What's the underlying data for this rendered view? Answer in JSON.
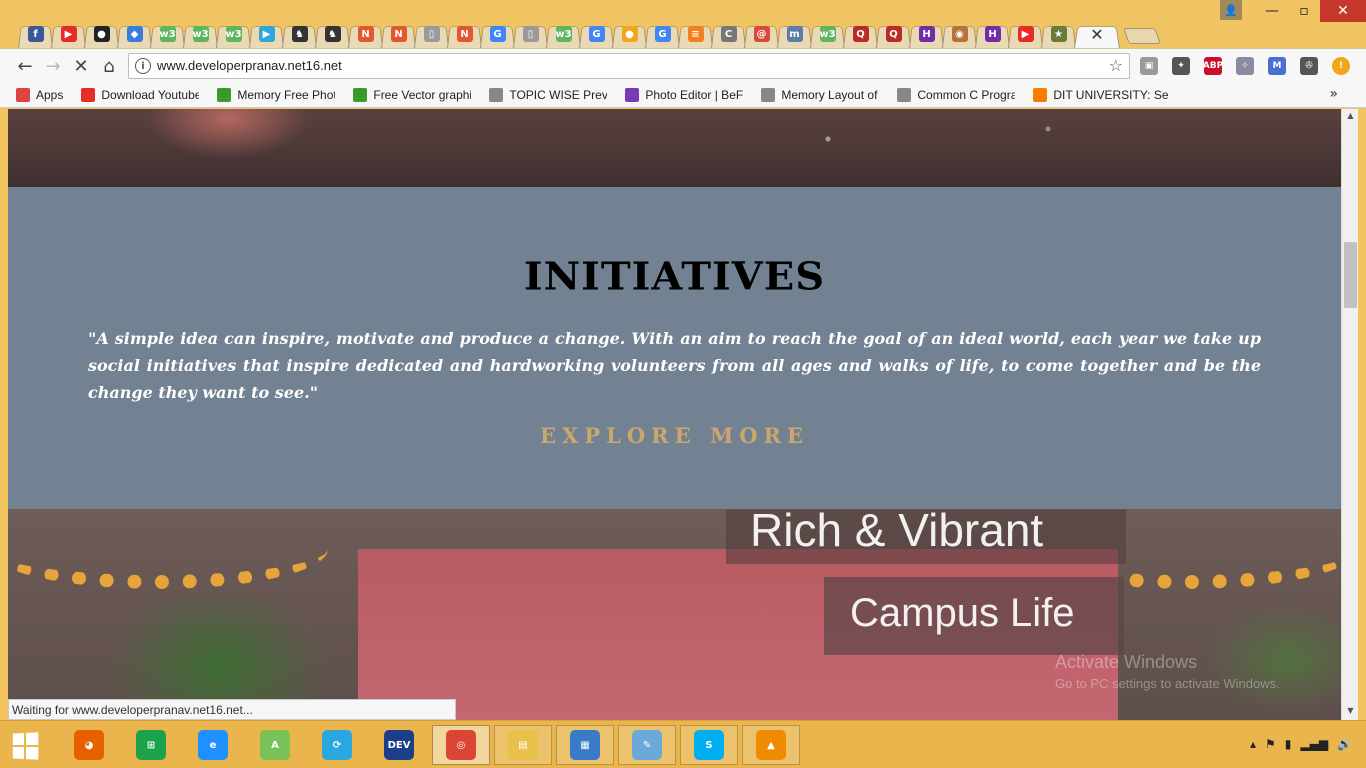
{
  "browser": {
    "url": "www.developerpranav.net16.net",
    "status_text": "Waiting for www.developerpranav.net16.net...",
    "tabs": [
      {
        "icon": "facebook-icon",
        "glyph": "f",
        "color": "#3b5998"
      },
      {
        "icon": "youtube-icon",
        "glyph": "▶",
        "color": "#e52d27"
      },
      {
        "icon": "github-icon",
        "glyph": "●",
        "color": "#222222"
      },
      {
        "icon": "google-ads-icon",
        "glyph": "◆",
        "color": "#3b7be0"
      },
      {
        "icon": "w3schools-icon",
        "glyph": "w3",
        "color": "#5fb55f"
      },
      {
        "icon": "w3schools-icon",
        "glyph": "w3",
        "color": "#5fb55f"
      },
      {
        "icon": "w3schools-icon",
        "glyph": "w3",
        "color": "#5fb55f"
      },
      {
        "icon": "play-icon",
        "glyph": "▶",
        "color": "#2fa7d8"
      },
      {
        "icon": "batman-icon",
        "glyph": "♞",
        "color": "#333333"
      },
      {
        "icon": "batman-icon",
        "glyph": "♞",
        "color": "#333333"
      },
      {
        "icon": "n-icon",
        "glyph": "N",
        "color": "#e2572b"
      },
      {
        "icon": "n-icon",
        "glyph": "N",
        "color": "#e2572b"
      },
      {
        "icon": "page-icon",
        "glyph": "▯",
        "color": "#9a9a9a"
      },
      {
        "icon": "n-icon",
        "glyph": "N",
        "color": "#e2572b"
      },
      {
        "icon": "google-icon",
        "glyph": "G",
        "color": "#4285f4"
      },
      {
        "icon": "page-icon",
        "glyph": "▯",
        "color": "#9a9a9a"
      },
      {
        "icon": "w3schools-icon",
        "glyph": "w3",
        "color": "#5fb55f"
      },
      {
        "icon": "google-icon",
        "glyph": "G",
        "color": "#4285f4"
      },
      {
        "icon": "orange-icon",
        "glyph": "●",
        "color": "#f2a51a"
      },
      {
        "icon": "google-icon",
        "glyph": "G",
        "color": "#4285f4"
      },
      {
        "icon": "stackoverflow-icon",
        "glyph": "≡",
        "color": "#f48024"
      },
      {
        "icon": "cpp-icon",
        "glyph": "C",
        "color": "#777777"
      },
      {
        "icon": "swirl-icon",
        "glyph": "@",
        "color": "#d84b3a"
      },
      {
        "icon": "m-icon",
        "glyph": "m",
        "color": "#5b7ea8"
      },
      {
        "icon": "w3schools-icon",
        "glyph": "w3",
        "color": "#5fb55f"
      },
      {
        "icon": "quora-icon",
        "glyph": "Q",
        "color": "#b92b27"
      },
      {
        "icon": "quora-icon",
        "glyph": "Q",
        "color": "#b92b27"
      },
      {
        "icon": "hackerearth-icon",
        "glyph": "H",
        "color": "#6f2da8"
      },
      {
        "icon": "owl-icon",
        "glyph": "◉",
        "color": "#b6723a"
      },
      {
        "icon": "hackerearth-icon",
        "glyph": "H",
        "color": "#6f2da8"
      },
      {
        "icon": "youtube-icon",
        "glyph": "▶",
        "color": "#e52d27"
      },
      {
        "icon": "figure-icon",
        "glyph": "★",
        "color": "#6a7a3a"
      }
    ],
    "active_tab_close": "✕",
    "bookmarks": [
      {
        "label": "Apps",
        "icon": "apps-icon",
        "color": "#d44"
      },
      {
        "label": "Download Youtube Vi",
        "icon": "youtube-icon",
        "color": "#e52d27"
      },
      {
        "label": "Memory Free Photos",
        "icon": "download-icon",
        "color": "#3a9a2a"
      },
      {
        "label": "Free Vector graphic a",
        "icon": "download-icon",
        "color": "#3a9a2a"
      },
      {
        "label": "TOPIC WISE Previous",
        "icon": "page-icon",
        "color": "#888888"
      },
      {
        "label": "Photo Editor | BeFunk",
        "icon": "befunky-icon",
        "color": "#7a3ab8"
      },
      {
        "label": "Memory Layout of C F",
        "icon": "page-icon",
        "color": "#888888"
      },
      {
        "label": "Common C Programm",
        "icon": "page-icon",
        "color": "#888888"
      },
      {
        "label": "DIT UNIVERSITY: Sept",
        "icon": "blogger-icon",
        "color": "#f57d00"
      }
    ],
    "extensions": [
      {
        "icon": "extension-box-icon",
        "glyph": "▣",
        "color": "#9a9a9a"
      },
      {
        "icon": "bag-icon",
        "glyph": "✦",
        "color": "#555555"
      },
      {
        "icon": "adblock-icon",
        "glyph": "ABP",
        "color": "#c8102e"
      },
      {
        "icon": "puzzle-icon",
        "glyph": "✧",
        "color": "#8a8aa0"
      },
      {
        "icon": "gmail-icon",
        "glyph": "M",
        "color": "#4a6fd1"
      },
      {
        "icon": "film-icon",
        "glyph": "✇",
        "color": "#555555"
      },
      {
        "icon": "alert-icon",
        "glyph": "!",
        "color": "#f2a51a"
      }
    ]
  },
  "page": {
    "section_title": "INITIATIVES",
    "quote": "\"A simple idea can inspire, motivate and produce a change. With an aim to reach the goal of an ideal world, each year we take up social initiatives that inspire dedicated and hardworking volunteers from all ages and walks of life, to come together and be the change they want to see.\"",
    "explore_label": "EXPLORE MORE",
    "banner_line1": "Rich & Vibrant",
    "banner_line2": "Campus Life"
  },
  "watermark": {
    "title": "Activate Windows",
    "subtitle": "Go to PC settings to activate Windows."
  },
  "taskbar": {
    "apps": [
      {
        "name": "firefox-taskbar-icon",
        "glyph": "◕",
        "color": "#e66000",
        "state": "pinned"
      },
      {
        "name": "store-taskbar-icon",
        "glyph": "⊞",
        "color": "#1aa34a",
        "state": "pinned"
      },
      {
        "name": "ie-taskbar-icon",
        "glyph": "e",
        "color": "#1e90ff",
        "state": "pinned"
      },
      {
        "name": "android-studio-taskbar-icon",
        "glyph": "A",
        "color": "#78c257",
        "state": "pinned"
      },
      {
        "name": "sync-taskbar-icon",
        "glyph": "⟳",
        "color": "#29a8e0",
        "state": "pinned"
      },
      {
        "name": "devcpp-taskbar-icon",
        "glyph": "DEV",
        "color": "#1c3f8a",
        "state": "pinned"
      },
      {
        "name": "chrome-taskbar-icon",
        "glyph": "◎",
        "color": "#db4437",
        "state": "active"
      },
      {
        "name": "explorer-taskbar-icon",
        "glyph": "▤",
        "color": "#e8c14a",
        "state": "open"
      },
      {
        "name": "photos-taskbar-icon",
        "glyph": "▦",
        "color": "#3a7bc8",
        "state": "open"
      },
      {
        "name": "notepad-taskbar-icon",
        "glyph": "✎",
        "color": "#6aa9d8",
        "state": "open"
      },
      {
        "name": "skype-taskbar-icon",
        "glyph": "S",
        "color": "#00aff0",
        "state": "open"
      },
      {
        "name": "vlc-taskbar-icon",
        "glyph": "▲",
        "color": "#f08a00",
        "state": "open"
      }
    ],
    "tray": [
      "▴",
      "⚑",
      "▮",
      "▂▄▆",
      "🔊"
    ]
  }
}
